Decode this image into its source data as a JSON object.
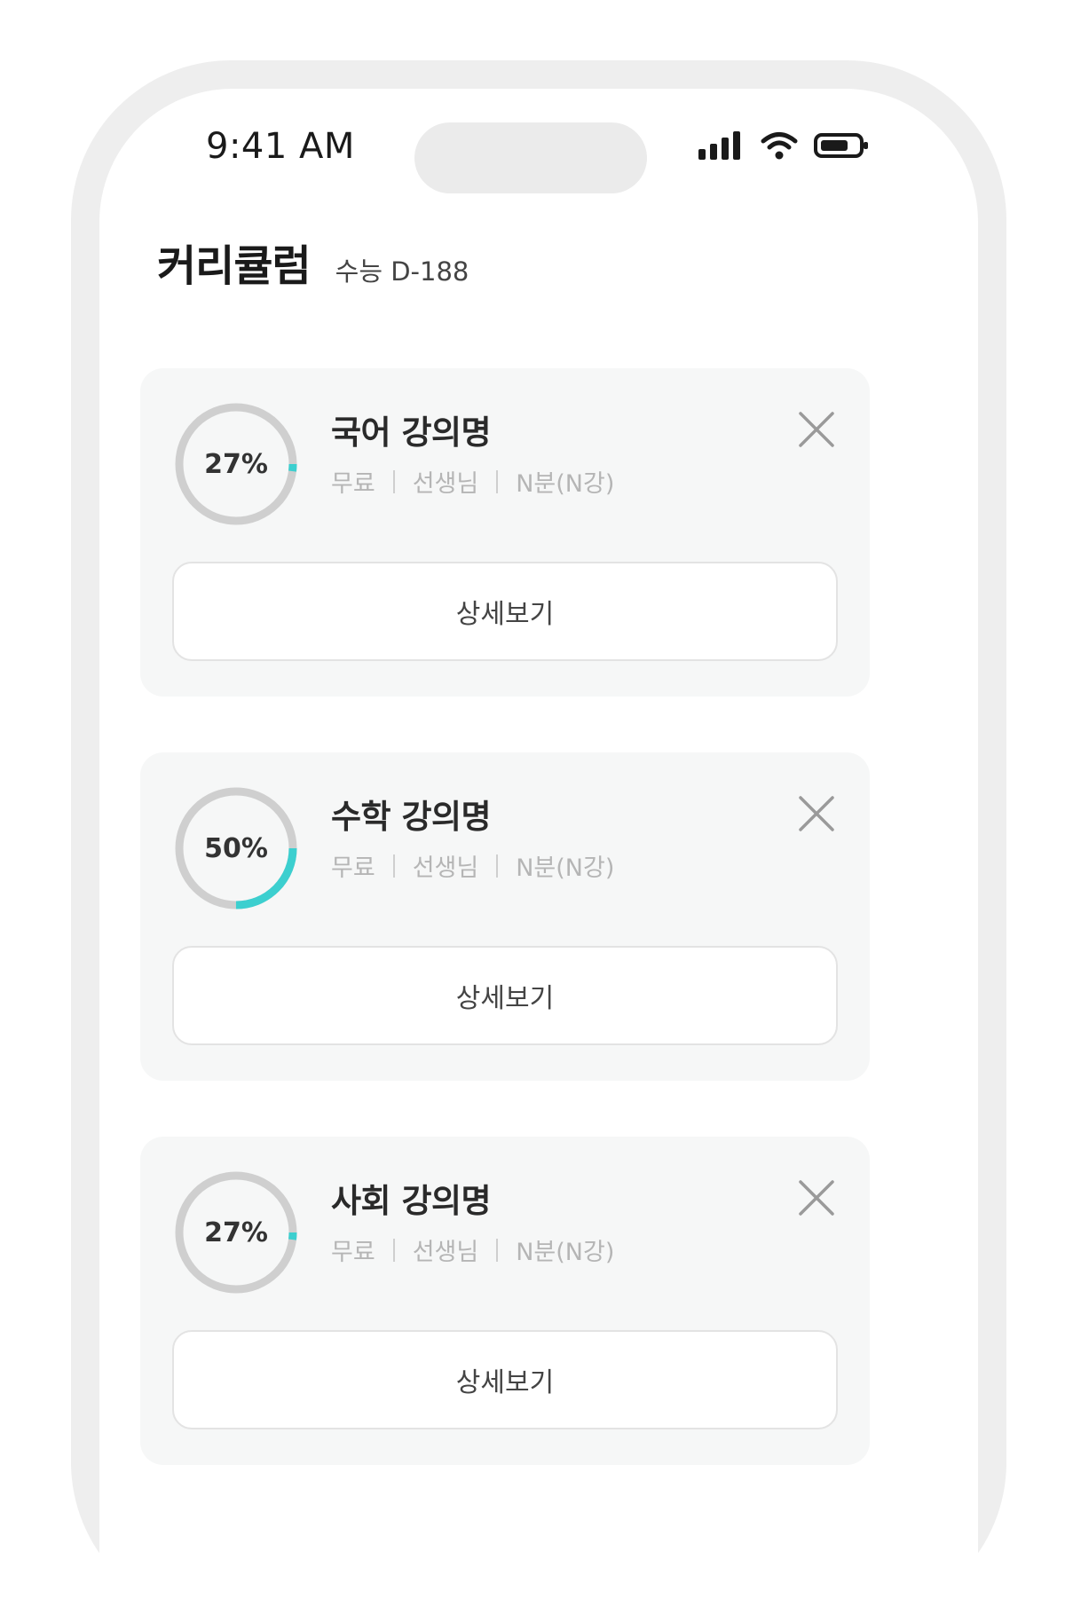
{
  "status_bar": {
    "time": "9:41 AM",
    "icons": [
      "cellular-signal-icon",
      "wifi-icon",
      "battery-icon"
    ]
  },
  "header": {
    "title": "커리큘럼",
    "dday": "수능 D-188"
  },
  "colors": {
    "progress_accent": "#3ccfcf",
    "progress_track": "#cfcfcf",
    "card_background": "#f6f7f7"
  },
  "courses": [
    {
      "title": "국어 강의명",
      "progress_percent": 27,
      "progress_label": "27%",
      "price": "무료",
      "teacher": "선생님",
      "duration": "N분(N강)",
      "detail_label": "상세보기"
    },
    {
      "title": "수학 강의명",
      "progress_percent": 50,
      "progress_label": "50%",
      "price": "무료",
      "teacher": "선생님",
      "duration": "N분(N강)",
      "detail_label": "상세보기"
    },
    {
      "title": "사회 강의명",
      "progress_percent": 27,
      "progress_label": "27%",
      "price": "무료",
      "teacher": "선생님",
      "duration": "N분(N강)",
      "detail_label": "상세보기"
    }
  ]
}
